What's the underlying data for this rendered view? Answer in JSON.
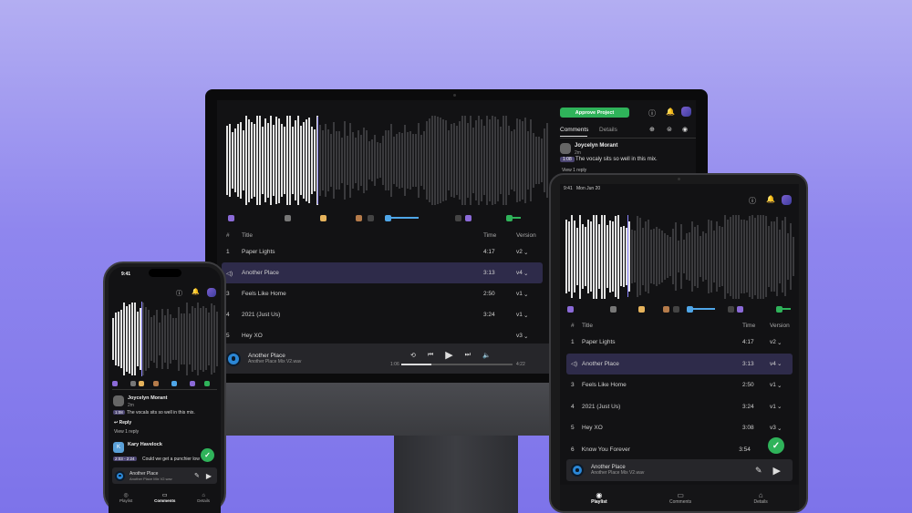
{
  "colors": {
    "accent": "#7d73ea",
    "approve": "#2fb35a",
    "active_row": "#2e2b4a",
    "disc": "#2b87d6"
  },
  "desktop": {
    "approve_label": "Approve Project",
    "tabs": [
      "Comments",
      "Details"
    ],
    "comment": {
      "author": "Joycelyn Morant",
      "age": "2m",
      "timestamp": "1:08",
      "text": "The vocaly sits so well in this mix.",
      "view_reply": "View 1 reply"
    },
    "table": {
      "headers": {
        "num": "#",
        "title": "Title",
        "time": "Time",
        "version": "Version"
      },
      "rows": [
        {
          "num": "1",
          "title": "Paper Lights",
          "time": "4:17",
          "version": "v2"
        },
        {
          "num": "",
          "title": "Another Place",
          "time": "3:13",
          "version": "v4"
        },
        {
          "num": "3",
          "title": "Feels Like Home",
          "time": "2:50",
          "version": "v1"
        },
        {
          "num": "4",
          "title": "2021 (Just Us)",
          "time": "3:24",
          "version": "v1"
        },
        {
          "num": "5",
          "title": "Hey XO",
          "time": "",
          "version": "v3"
        }
      ]
    },
    "player": {
      "title": "Another Place",
      "subtitle": "Another Place Mix V2.wav",
      "elapsed": "1:06",
      "total": "4:22",
      "progress": 0.27
    }
  },
  "tablet": {
    "status_time": "9:41",
    "status_date": "Mon Jun 20",
    "table": {
      "headers": {
        "num": "#",
        "title": "Title",
        "time": "Time",
        "version": "Version"
      },
      "rows": [
        {
          "num": "1",
          "title": "Paper Lights",
          "time": "4:17",
          "version": "v2"
        },
        {
          "num": "",
          "title": "Another Place",
          "time": "3:13",
          "version": "v4"
        },
        {
          "num": "3",
          "title": "Feels Like Home",
          "time": "2:50",
          "version": "v1"
        },
        {
          "num": "4",
          "title": "2021 (Just Us)",
          "time": "3:24",
          "version": "v1"
        },
        {
          "num": "5",
          "title": "Hey XO",
          "time": "3:08",
          "version": "v3"
        },
        {
          "num": "6",
          "title": "Know You Forever",
          "time": "3:54",
          "version": ""
        }
      ]
    },
    "player": {
      "title": "Another Place",
      "subtitle": "Another Place Mix V2.wav"
    },
    "nav": [
      "Playlist",
      "Comments",
      "Details"
    ]
  },
  "phone": {
    "status_time": "9:41",
    "comments": [
      {
        "author": "Joycelyn Morant",
        "age": "2m",
        "timestamp": "1:08",
        "text": "The vocals sits so well in this mix.",
        "reply": "Reply",
        "view_reply": "View 1 reply"
      },
      {
        "author": "Kary Havelock",
        "initial": "K",
        "timestamp": "2:03 - 2:24",
        "text": "Could we get a punchier low"
      }
    ],
    "player": {
      "title": "Another Place",
      "subtitle": "Another Place Mix V2.wav"
    },
    "nav": [
      "Playlist",
      "Comments",
      "Details"
    ]
  }
}
